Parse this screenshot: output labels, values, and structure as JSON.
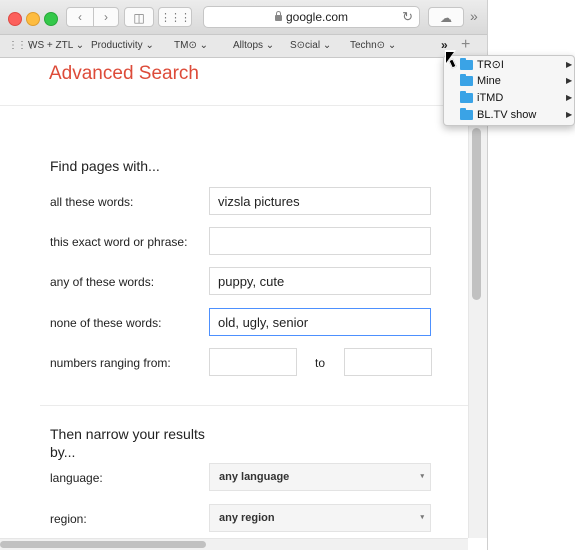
{
  "browser": {
    "url_text": "google.com",
    "reload_glyph": "↻",
    "nav_back_glyph": "‹",
    "nav_fwd_glyph": "›",
    "sidebar_glyph": "◫",
    "topsites_glyph": "⋮⋮⋮",
    "share_glyph": "☁",
    "toolbar_overflow_glyph": "»"
  },
  "bookmarks_bar": {
    "grid_glyph": "⋮⋮⋮",
    "items": [
      "WS + ZTL ⌄",
      "Productivity ⌄",
      "TM⊙ ⌄",
      "Alltops ⌄",
      "S⊙cial ⌄",
      "Techn⊙ ⌄"
    ],
    "overflow_glyph": "»",
    "add_glyph": "+"
  },
  "bookmarks_menu": {
    "items": [
      {
        "label": "TR⊙I",
        "arrow": "▶"
      },
      {
        "label": "Mine",
        "arrow": "▶"
      },
      {
        "label": "iTMD",
        "arrow": "▶"
      },
      {
        "label": "BL.TV show",
        "arrow": "▶"
      }
    ]
  },
  "page": {
    "title": "Advanced Search",
    "title_color": "#dd4b39",
    "section_find": "Find pages with...",
    "fields": [
      {
        "label": "all these words:",
        "value": "vizsla pictures"
      },
      {
        "label": "this exact word or phrase:",
        "value": ""
      },
      {
        "label": "any of these words:",
        "value": "puppy, cute"
      },
      {
        "label": "none of these words:",
        "value": "old, ugly, senior"
      }
    ],
    "numbers_label": "numbers ranging from:",
    "to_label": "to",
    "section_narrow": "Then narrow your results by...",
    "language_label": "language:",
    "language_value": "any language",
    "region_label": "region:",
    "region_value": "any region",
    "dropdown_arrow": "▾"
  }
}
